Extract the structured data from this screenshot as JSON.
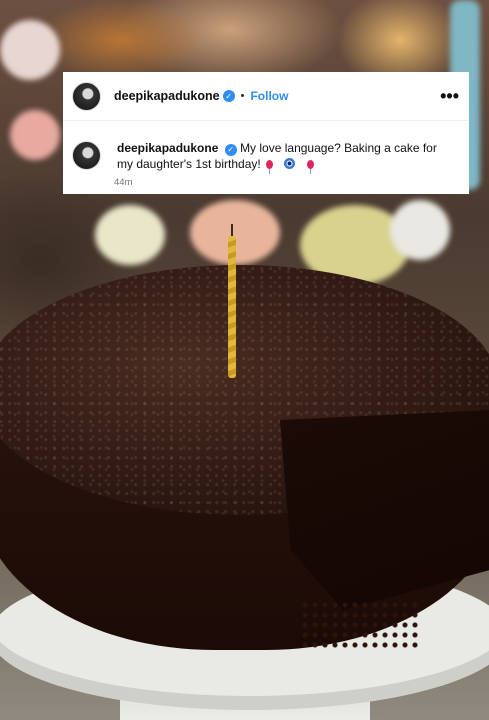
{
  "post": {
    "username": "deepikapadukone",
    "verified_glyph": "✓",
    "dot": "•",
    "follow_label": "Follow",
    "more_label": "•••",
    "caption_text": "My love language? Baking a cake for my daughter's 1st birthday!",
    "caption_emojis": [
      "balloon",
      "nazar-amulet",
      "balloon"
    ],
    "timestamp": "44m"
  },
  "colors": {
    "accent": "#2f8cf0",
    "text": "#111111",
    "muted": "#737373"
  }
}
